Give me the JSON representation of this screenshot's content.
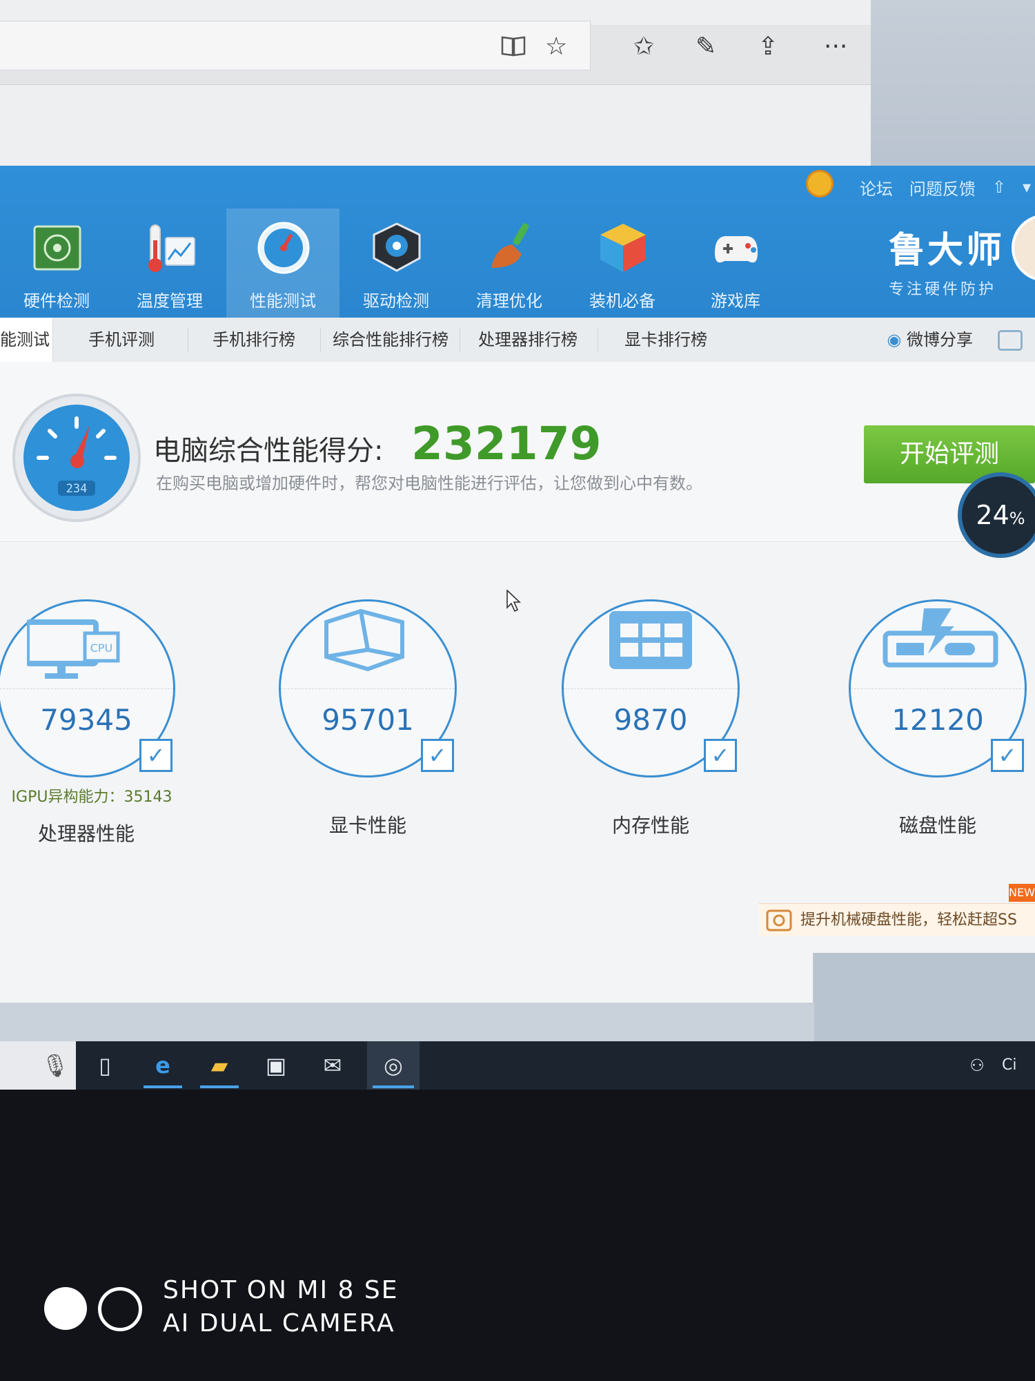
{
  "browser": {
    "icons": [
      "reading-view-icon",
      "favorite-star-icon",
      "favorites-list-icon",
      "pen-icon",
      "share-icon",
      "more-icon"
    ],
    "more_label": "···"
  },
  "app": {
    "top_links": [
      "论坛",
      "问题反馈"
    ],
    "nav": [
      {
        "label": "硬件检测",
        "icon": "hardware-board-icon"
      },
      {
        "label": "温度管理",
        "icon": "thermometer-icon"
      },
      {
        "label": "性能测试",
        "icon": "speedometer-icon"
      },
      {
        "label": "驱动检测",
        "icon": "driver-gear-icon"
      },
      {
        "label": "清理优化",
        "icon": "broom-icon"
      },
      {
        "label": "装机必备",
        "icon": "cube-icon"
      },
      {
        "label": "游戏库",
        "icon": "gamepad-icon"
      }
    ],
    "brand": {
      "name": "鲁大师",
      "slogan": "专注硬件防护"
    },
    "tabs": [
      "能测试",
      "手机评测",
      "手机排行榜",
      "综合性能排行榜",
      "处理器排行榜",
      "显卡排行榜"
    ],
    "share_label": "微博分享",
    "score": {
      "title": "电脑综合性能得分:",
      "value": "232179",
      "description": "在购买电脑或增加硬件时，帮您对电脑性能进行评估，让您做到心中有数。",
      "gauge_text": "234"
    },
    "start_button": "开始评测",
    "progress": {
      "value": "24",
      "unit": "%"
    },
    "metrics": [
      {
        "name": "处理器性能",
        "value": "79345",
        "extra": "IGPU异构能力：35143",
        "icon": "cpu-monitor-icon"
      },
      {
        "name": "显卡性能",
        "value": "95701",
        "icon": "gpu-box-icon"
      },
      {
        "name": "内存性能",
        "value": "9870",
        "icon": "memory-chip-icon"
      },
      {
        "name": "磁盘性能",
        "value": "12120",
        "icon": "disk-drive-icon"
      }
    ],
    "banner": {
      "tag": "NEW",
      "text": "提升机械硬盘性能，轻松赶超SS"
    }
  },
  "taskbar": {
    "icons": [
      "microphone-icon",
      "task-view-icon",
      "edge-icon",
      "file-explorer-icon",
      "store-icon",
      "mail-icon",
      "ludashi-app-icon",
      "people-icon"
    ],
    "tray_text": "Ci"
  },
  "watermark": {
    "line1": "SHOT ON MI 8 SE",
    "line2": "AI DUAL CAMERA"
  },
  "colors": {
    "topbar": "#2f8fd8",
    "score": "#3f9a29",
    "start_button": "#6cbd3a",
    "metric_ring": "#3a8fd2"
  }
}
